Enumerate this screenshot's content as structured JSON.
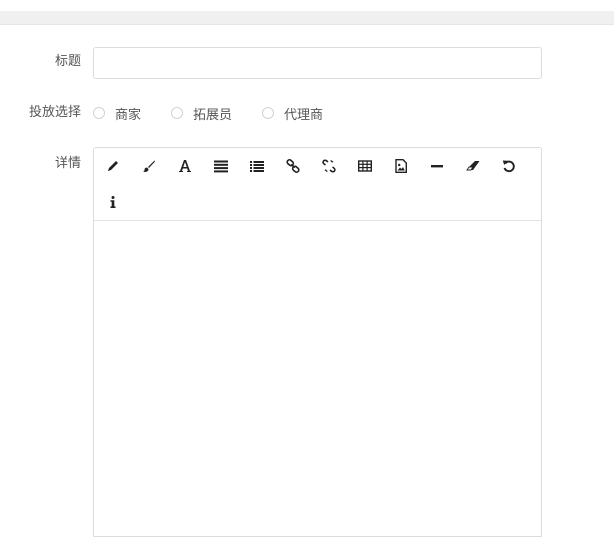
{
  "form": {
    "title_label": "标题",
    "title_value": "",
    "target_label": "投放选择",
    "target_options": [
      "商家",
      "拓展员",
      "代理商"
    ],
    "detail_label": "详情"
  },
  "editor": {
    "toolbar_icons": [
      "pencil-icon",
      "brush-icon",
      "font-icon",
      "align-justify-icon",
      "list-icon",
      "link-icon",
      "unlink-icon",
      "table-icon",
      "image-icon",
      "horizontal-rule-icon",
      "eraser-icon",
      "undo-icon",
      "info-icon"
    ],
    "content": ""
  },
  "colors": {
    "icon": "#222222",
    "border": "#dcdcdc",
    "label": "#555555"
  }
}
